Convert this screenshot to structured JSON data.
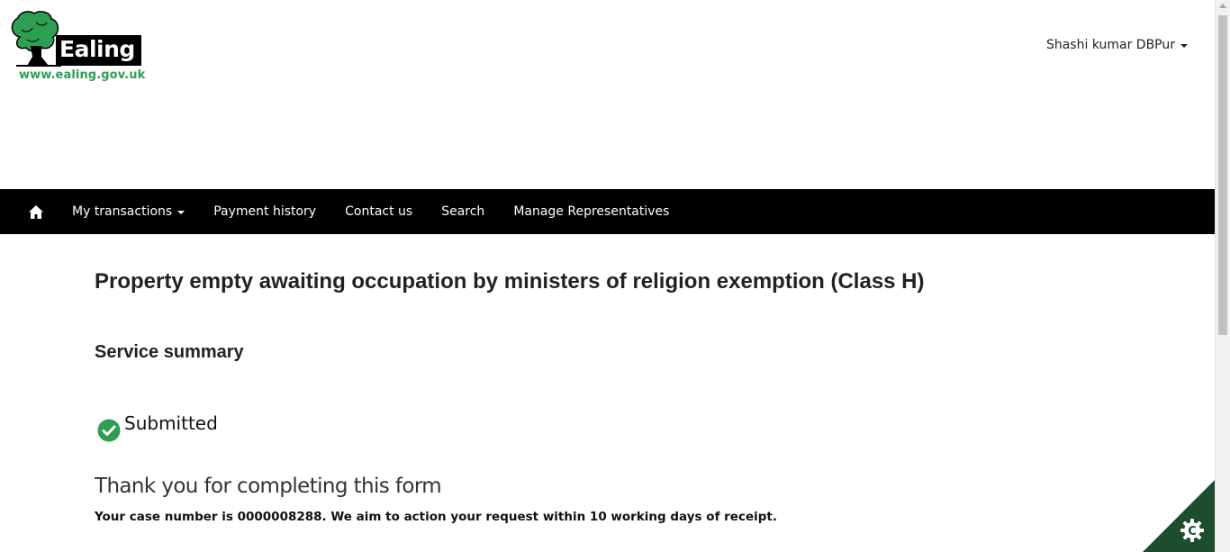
{
  "header": {
    "logo_alt": "Ealing",
    "logo_text": "Ealing",
    "logo_url_text": "www.ealing.gov.uk",
    "user_name": "Shashi kumar DBPur"
  },
  "nav": {
    "home_icon": "home-icon",
    "items": [
      {
        "label": "My transactions",
        "has_dropdown": true
      },
      {
        "label": "Payment history"
      },
      {
        "label": "Contact us"
      },
      {
        "label": "Search"
      },
      {
        "label": "Manage Representatives"
      }
    ]
  },
  "main": {
    "title": "Property empty awaiting occupation by ministers of religion exemption (Class H)",
    "section_heading": "Service summary",
    "status": {
      "icon": "check-circle-icon",
      "label": "Submitted"
    },
    "thanks_heading": "Thank you for completing this form",
    "case_message": "Your case number is 0000008288. We aim to action your request within 10 working days of receipt."
  },
  "corner_widget": {
    "icon": "cookie-settings-icon"
  },
  "colors": {
    "brand_green": "#2e9e52",
    "nav_bg": "#000000",
    "corner_green": "#1d4d2f"
  }
}
